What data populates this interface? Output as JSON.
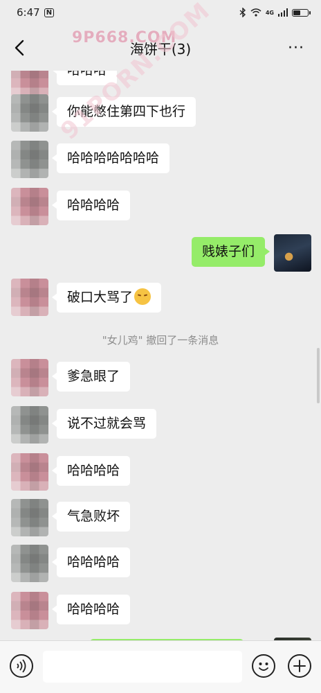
{
  "status_bar": {
    "time": "6:47",
    "n_icon": "N",
    "bluetooth_icon": "bluetooth-icon",
    "wifi_icon": "wifi-icon",
    "network_label": "4G",
    "signal_icon": "signal-icon",
    "battery_level": 0.45
  },
  "header": {
    "title": "海饼干(3)",
    "watermark": "9P668.COM",
    "watermark_diagonal": "91PORN.COM",
    "back_icon": "back-chevron-icon",
    "more_icon": "more-dots-icon",
    "more_label": "···"
  },
  "messages": [
    {
      "side": "left",
      "text": "哈哈哈"
    },
    {
      "side": "left",
      "text": "你能憋住第四下也行"
    },
    {
      "side": "left",
      "text": "哈哈哈哈哈哈哈"
    },
    {
      "side": "left",
      "text": "哈哈哈哈"
    },
    {
      "side": "right",
      "text": "贱婊子们"
    },
    {
      "side": "left",
      "text": "破口大骂了",
      "emoji": "angry-face-emoji"
    },
    {
      "side": "system",
      "text": "\"女儿鸡\" 撤回了一条消息"
    },
    {
      "side": "left",
      "text": "爹急眼了"
    },
    {
      "side": "left",
      "text": "说不过就会骂"
    },
    {
      "side": "left",
      "text": "哈哈哈哈"
    },
    {
      "side": "left",
      "text": "气急败坏"
    },
    {
      "side": "left",
      "text": "哈哈哈哈"
    },
    {
      "side": "left",
      "text": "哈哈哈哈"
    }
  ],
  "input_bar": {
    "value": "",
    "voice_icon": "voice-icon",
    "emoji_icon": "emoji-face-icon",
    "plus_icon": "plus-icon"
  },
  "colors": {
    "background": "#ededed",
    "bubble_self": "#95ec69",
    "bubble_other": "#ffffff",
    "system_text": "#8c8c8c"
  }
}
